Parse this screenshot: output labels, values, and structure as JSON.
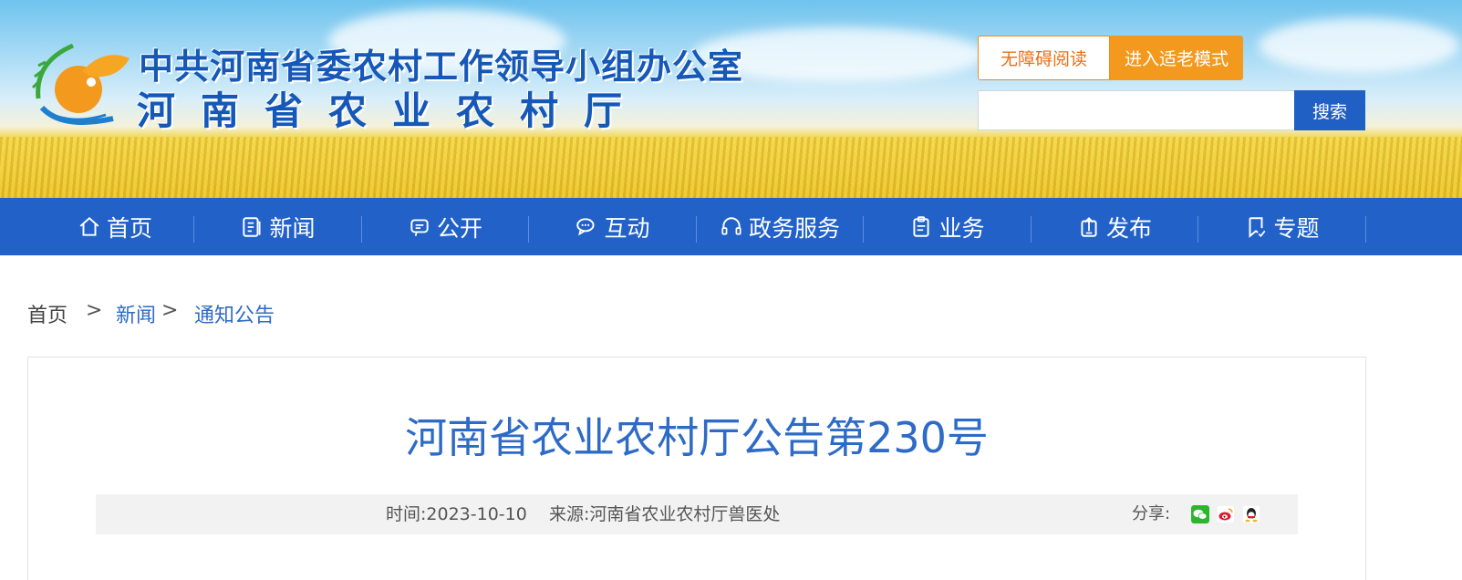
{
  "header": {
    "org_line1": "中共河南省委农村工作领导小组办公室",
    "org_line2": "河南省农业农村厅",
    "accessibility_label": "无障碍阅读",
    "elder_mode_label": "进入适老模式",
    "search": {
      "value": "",
      "placeholder": "",
      "button_label": "搜索"
    }
  },
  "nav": {
    "items": [
      {
        "label": "首页",
        "icon": "home-icon"
      },
      {
        "label": "新闻",
        "icon": "news-icon"
      },
      {
        "label": "公开",
        "icon": "disclosure-icon"
      },
      {
        "label": "互动",
        "icon": "chat-icon"
      },
      {
        "label": "政务服务",
        "icon": "headset-icon"
      },
      {
        "label": "业务",
        "icon": "clipboard-icon"
      },
      {
        "label": "发布",
        "icon": "upload-icon"
      },
      {
        "label": "专题",
        "icon": "bookmark-icon"
      }
    ]
  },
  "breadcrumb": {
    "home": "首页",
    "sep": ">",
    "news": "新闻",
    "notice": "通知公告"
  },
  "article": {
    "title": "河南省农业农村厅公告第230号",
    "time_label": "时间:",
    "time_value": "2023-10-10",
    "source_label": "来源:",
    "source_value": "河南省农业农村厅兽医处",
    "share_label": "分享:",
    "share_icons": [
      "wechat-icon",
      "weibo-icon",
      "qq-icon"
    ]
  },
  "colors": {
    "brand_blue": "#2262c8",
    "title_blue": "#2e6bc6",
    "accent_orange": "#f39a1e"
  }
}
